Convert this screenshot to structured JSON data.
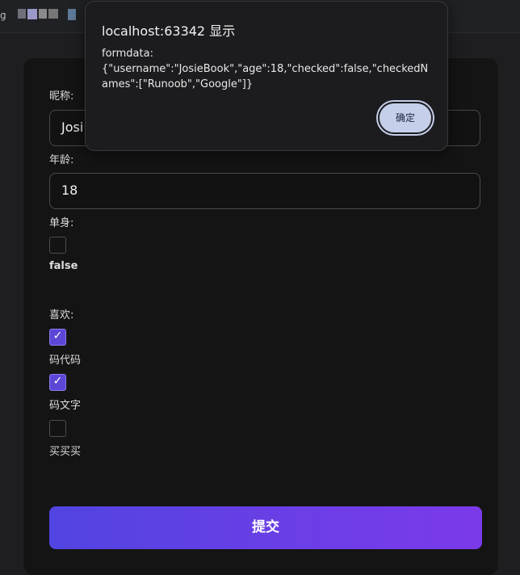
{
  "browser": {
    "tab_fragment": "g"
  },
  "form": {
    "nickname_label": "昵称:",
    "nickname_value": "Josi",
    "age_label": "年龄:",
    "age_value": "18",
    "single_label": "单身:",
    "single_checked": false,
    "single_value_text": "false",
    "likes_label": "喜欢:",
    "likes_options": [
      {
        "label": "码代码",
        "checked": true
      },
      {
        "label": "码文字",
        "checked": true
      },
      {
        "label": "买买买",
        "checked": false
      }
    ],
    "submit_label": "提交"
  },
  "dialog": {
    "title": "localhost:63342 显示",
    "message_line1": "formdata:",
    "message_line2": "{\"username\":\"JosieBook\",\"age\":18,\"checked\":false,\"checkedNames\":[\"Runoob\",\"Google\"]}",
    "ok_label": "确定"
  },
  "colors": {
    "accent_start": "#5144e0",
    "accent_end": "#7b3aea",
    "checkbox_checked": "#5b47d6",
    "dialog_button": "#c5cfea"
  }
}
